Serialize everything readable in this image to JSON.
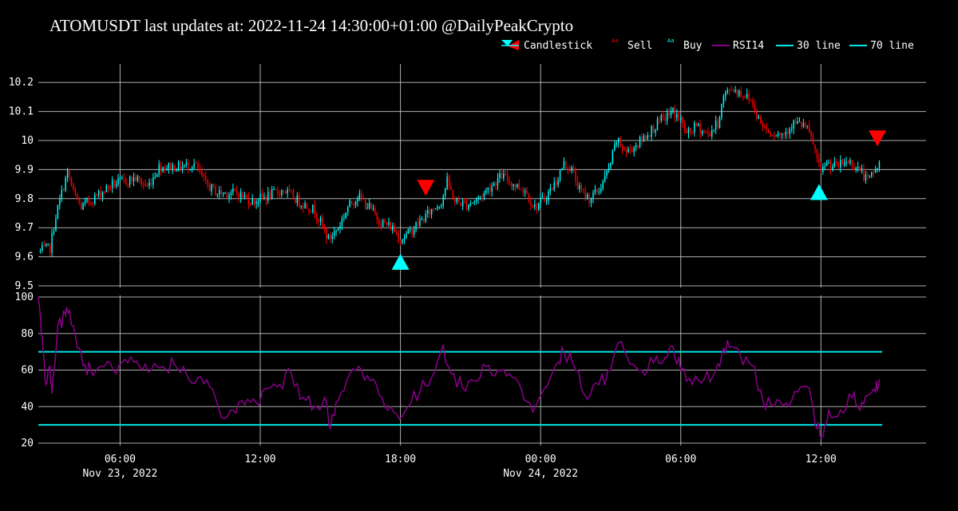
{
  "title": "ATOMUSDT last updates at: 2022-11-24 14:30:00+01:00 @DailyPeakCrypto",
  "colors": {
    "background": "#000000",
    "up": "#00ffff",
    "down": "#ff0000",
    "rsi": "#8b008b",
    "threshold_lines": "#00e5e5",
    "grid": "#cccccc",
    "text": "#ffffff"
  },
  "legend": {
    "placement": "top-right",
    "items": [
      {
        "label": "Candlestick",
        "marker": "candlestick"
      },
      {
        "label": "Sell",
        "marker": "sell-triangle"
      },
      {
        "label": "Buy",
        "marker": "buy-triangle"
      },
      {
        "label": "RSI14",
        "marker": "rsi-line"
      },
      {
        "label": "30 line",
        "marker": "threshold-line"
      },
      {
        "label": "70 line",
        "marker": "threshold-line"
      }
    ]
  },
  "chart_data": [
    {
      "type": "candlestick",
      "panel": "price",
      "x_range": [
        "2022-11-23 02:30",
        "2022-11-24 16:30"
      ],
      "ylim": [
        9.5,
        10.25
      ],
      "y_ticks": [
        "9.5",
        "9.6",
        "9.7",
        "9.8",
        "9.9",
        "10",
        "10.1",
        "10.2"
      ],
      "x_ticks": [
        {
          "time": "2022-11-23 06:00",
          "label": "06:00",
          "date_label": "Nov 23, 2022"
        },
        {
          "time": "2022-11-23 12:00",
          "label": "12:00",
          "date_label": ""
        },
        {
          "time": "2022-11-23 18:00",
          "label": "18:00",
          "date_label": ""
        },
        {
          "time": "2022-11-24 00:00",
          "label": "00:00",
          "date_label": "Nov 24, 2022"
        },
        {
          "time": "2022-11-24 06:00",
          "label": "06:00",
          "date_label": ""
        },
        {
          "time": "2022-11-24 12:00",
          "label": "12:00",
          "date_label": ""
        }
      ],
      "grid": true,
      "interval_minutes": 5,
      "close_path": [
        [
          "2022-11-23 02:35",
          9.62
        ],
        [
          "2022-11-23 03:00",
          9.63
        ],
        [
          "2022-11-23 03:15",
          9.74
        ],
        [
          "2022-11-23 03:30",
          9.82
        ],
        [
          "2022-11-23 03:45",
          9.89
        ],
        [
          "2022-11-23 04:00",
          9.82
        ],
        [
          "2022-11-23 04:20",
          9.77
        ],
        [
          "2022-11-23 05:00",
          9.81
        ],
        [
          "2022-11-23 05:40",
          9.85
        ],
        [
          "2022-11-23 06:10",
          9.86
        ],
        [
          "2022-11-23 06:40",
          9.87
        ],
        [
          "2022-11-23 07:10",
          9.84
        ],
        [
          "2022-11-23 07:40",
          9.91
        ],
        [
          "2022-11-23 08:10",
          9.91
        ],
        [
          "2022-11-23 08:40",
          9.91
        ],
        [
          "2022-11-23 09:10",
          9.92
        ],
        [
          "2022-11-23 09:40",
          9.85
        ],
        [
          "2022-11-23 10:10",
          9.82
        ],
        [
          "2022-11-23 11:00",
          9.82
        ],
        [
          "2022-11-23 11:40",
          9.79
        ],
        [
          "2022-11-23 12:20",
          9.81
        ],
        [
          "2022-11-23 13:00",
          9.83
        ],
        [
          "2022-11-23 13:40",
          9.79
        ],
        [
          "2022-11-23 14:20",
          9.76
        ],
        [
          "2022-11-23 14:55",
          9.66
        ],
        [
          "2022-11-23 15:20",
          9.7
        ],
        [
          "2022-11-23 15:45",
          9.77
        ],
        [
          "2022-11-23 16:10",
          9.81
        ],
        [
          "2022-11-23 16:40",
          9.77
        ],
        [
          "2022-11-23 17:10",
          9.72
        ],
        [
          "2022-11-23 17:40",
          9.7
        ],
        [
          "2022-11-23 18:00",
          9.66
        ],
        [
          "2022-11-23 18:20",
          9.68
        ],
        [
          "2022-11-23 18:50",
          9.72
        ],
        [
          "2022-11-23 19:20",
          9.76
        ],
        [
          "2022-11-23 19:45",
          9.79
        ],
        [
          "2022-11-23 20:00",
          9.86
        ],
        [
          "2022-11-23 20:20",
          9.79
        ],
        [
          "2022-11-23 20:50",
          9.78
        ],
        [
          "2022-11-23 21:20",
          9.8
        ],
        [
          "2022-11-23 21:50",
          9.84
        ],
        [
          "2022-11-23 22:20",
          9.88
        ],
        [
          "2022-11-23 22:50",
          9.85
        ],
        [
          "2022-11-23 23:20",
          9.83
        ],
        [
          "2022-11-23 23:45",
          9.77
        ],
        [
          "2022-11-24 00:10",
          9.8
        ],
        [
          "2022-11-24 00:40",
          9.86
        ],
        [
          "2022-11-24 01:00",
          9.92
        ],
        [
          "2022-11-24 01:20",
          9.9
        ],
        [
          "2022-11-24 01:40",
          9.83
        ],
        [
          "2022-11-24 02:05",
          9.8
        ],
        [
          "2022-11-24 02:30",
          9.83
        ],
        [
          "2022-11-24 02:55",
          9.9
        ],
        [
          "2022-11-24 03:15",
          10.0
        ],
        [
          "2022-11-24 03:40",
          9.96
        ],
        [
          "2022-11-24 04:10",
          9.99
        ],
        [
          "2022-11-24 04:40",
          10.03
        ],
        [
          "2022-11-24 05:10",
          10.07
        ],
        [
          "2022-11-24 05:40",
          10.1
        ],
        [
          "2022-11-24 06:00",
          10.07
        ],
        [
          "2022-11-24 06:15",
          10.02
        ],
        [
          "2022-11-24 06:40",
          10.05
        ],
        [
          "2022-11-24 07:10",
          10.02
        ],
        [
          "2022-11-24 07:35",
          10.06
        ],
        [
          "2022-11-24 07:50",
          10.15
        ],
        [
          "2022-11-24 08:10",
          10.18
        ],
        [
          "2022-11-24 08:40",
          10.16
        ],
        [
          "2022-11-24 09:00",
          10.14
        ],
        [
          "2022-11-24 09:25",
          10.06
        ],
        [
          "2022-11-24 09:50",
          10.03
        ],
        [
          "2022-11-24 10:20",
          10.02
        ],
        [
          "2022-11-24 10:50",
          10.06
        ],
        [
          "2022-11-24 11:20",
          10.05
        ],
        [
          "2022-11-24 11:40",
          9.99
        ],
        [
          "2022-11-24 12:00",
          9.88
        ],
        [
          "2022-11-24 12:10",
          9.92
        ],
        [
          "2022-11-24 12:40",
          9.91
        ],
        [
          "2022-11-24 13:10",
          9.93
        ],
        [
          "2022-11-24 13:40",
          9.9
        ],
        [
          "2022-11-24 14:00",
          9.86
        ],
        [
          "2022-11-24 14:20",
          9.9
        ],
        [
          "2022-11-24 14:30",
          9.92
        ]
      ],
      "signals": [
        {
          "type": "buy",
          "time": "2022-11-23 18:00",
          "price": 9.58
        },
        {
          "type": "sell",
          "time": "2022-11-23 19:05",
          "price": 9.84
        },
        {
          "type": "buy",
          "time": "2022-11-24 11:55",
          "price": 9.82
        },
        {
          "type": "sell",
          "time": "2022-11-24 14:25",
          "price": 10.01
        }
      ]
    },
    {
      "type": "line",
      "panel": "rsi",
      "ylim": [
        20,
        100
      ],
      "y_ticks": [
        "20",
        "40",
        "60",
        "80",
        "100"
      ],
      "grid": true,
      "series": [
        {
          "name": "RSI14",
          "points": [
            [
              "2022-11-23 02:30",
              100
            ],
            [
              "2022-11-23 02:40",
              78
            ],
            [
              "2022-11-23 02:50",
              52
            ],
            [
              "2022-11-23 03:00",
              62
            ],
            [
              "2022-11-23 03:05",
              47
            ],
            [
              "2022-11-23 03:20",
              84
            ],
            [
              "2022-11-23 03:40",
              90
            ],
            [
              "2022-11-23 03:50",
              93
            ],
            [
              "2022-11-23 04:10",
              72
            ],
            [
              "2022-11-23 04:30",
              63
            ],
            [
              "2022-11-23 04:50",
              57
            ],
            [
              "2022-11-23 05:20",
              62
            ],
            [
              "2022-11-23 05:50",
              58
            ],
            [
              "2022-11-23 06:20",
              64
            ],
            [
              "2022-11-23 06:50",
              62
            ],
            [
              "2022-11-23 07:20",
              60
            ],
            [
              "2022-11-23 07:50",
              62
            ],
            [
              "2022-11-23 08:20",
              63
            ],
            [
              "2022-11-23 08:50",
              58
            ],
            [
              "2022-11-23 09:20",
              56
            ],
            [
              "2022-11-23 09:50",
              51
            ],
            [
              "2022-11-23 10:20",
              34
            ],
            [
              "2022-11-23 10:50",
              38
            ],
            [
              "2022-11-23 11:20",
              41
            ],
            [
              "2022-11-23 11:50",
              42
            ],
            [
              "2022-11-23 12:20",
              50
            ],
            [
              "2022-11-23 12:50",
              52
            ],
            [
              "2022-11-23 13:20",
              58
            ],
            [
              "2022-11-23 13:50",
              45
            ],
            [
              "2022-11-23 14:20",
              40
            ],
            [
              "2022-11-23 14:45",
              45
            ],
            [
              "2022-11-23 15:00",
              28
            ],
            [
              "2022-11-23 15:20",
              43
            ],
            [
              "2022-11-23 15:50",
              58
            ],
            [
              "2022-11-23 16:20",
              60
            ],
            [
              "2022-11-23 16:50",
              55
            ],
            [
              "2022-11-23 17:20",
              40
            ],
            [
              "2022-11-23 17:50",
              36
            ],
            [
              "2022-11-23 18:20",
              40
            ],
            [
              "2022-11-23 18:50",
              48
            ],
            [
              "2022-11-23 19:20",
              56
            ],
            [
              "2022-11-23 19:50",
              74
            ],
            [
              "2022-11-23 20:10",
              58
            ],
            [
              "2022-11-23 20:40",
              50
            ],
            [
              "2022-11-23 21:10",
              54
            ],
            [
              "2022-11-23 21:40",
              62
            ],
            [
              "2022-11-23 22:10",
              60
            ],
            [
              "2022-11-23 22:40",
              58
            ],
            [
              "2022-11-23 23:10",
              50
            ],
            [
              "2022-11-23 23:40",
              37
            ],
            [
              "2022-11-24 00:10",
              50
            ],
            [
              "2022-11-24 00:40",
              63
            ],
            [
              "2022-11-24 01:00",
              70
            ],
            [
              "2022-11-24 01:30",
              60
            ],
            [
              "2022-11-24 02:00",
              44
            ],
            [
              "2022-11-24 02:30",
              52
            ],
            [
              "2022-11-24 03:00",
              60
            ],
            [
              "2022-11-24 03:20",
              75
            ],
            [
              "2022-11-24 03:50",
              63
            ],
            [
              "2022-11-24 04:20",
              60
            ],
            [
              "2022-11-24 04:50",
              64
            ],
            [
              "2022-11-24 05:20",
              67
            ],
            [
              "2022-11-24 05:40",
              73
            ],
            [
              "2022-11-24 06:00",
              60
            ],
            [
              "2022-11-24 06:30",
              52
            ],
            [
              "2022-11-24 07:00",
              55
            ],
            [
              "2022-11-24 07:30",
              60
            ],
            [
              "2022-11-24 07:50",
              72
            ],
            [
              "2022-11-24 08:10",
              73
            ],
            [
              "2022-11-24 08:40",
              63
            ],
            [
              "2022-11-24 09:10",
              62
            ],
            [
              "2022-11-24 09:30",
              44
            ],
            [
              "2022-11-24 10:00",
              40
            ],
            [
              "2022-11-24 10:30",
              42
            ],
            [
              "2022-11-24 11:00",
              48
            ],
            [
              "2022-11-24 11:30",
              50
            ],
            [
              "2022-11-24 11:50",
              28
            ],
            [
              "2022-11-24 12:00",
              23
            ],
            [
              "2022-11-24 12:20",
              38
            ],
            [
              "2022-11-24 12:50",
              38
            ],
            [
              "2022-11-24 13:20",
              45
            ],
            [
              "2022-11-24 13:40",
              38
            ],
            [
              "2022-11-24 14:00",
              46
            ],
            [
              "2022-11-24 14:20",
              48
            ],
            [
              "2022-11-24 14:30",
              55
            ]
          ]
        },
        {
          "name": "30 line",
          "value": 30
        },
        {
          "name": "70 line",
          "value": 70
        }
      ]
    }
  ]
}
